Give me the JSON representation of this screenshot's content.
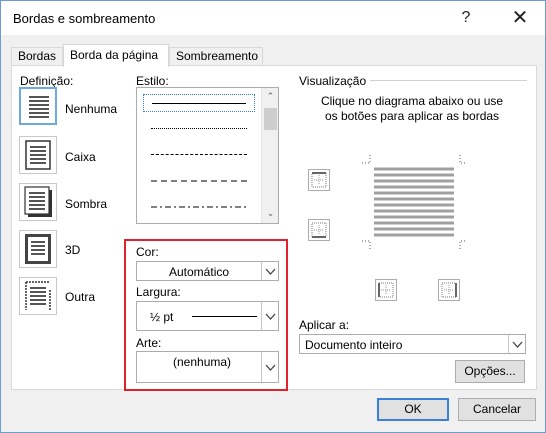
{
  "window": {
    "title": "Bordas e sombreamento",
    "help_glyph": "?",
    "close_glyph": "✕"
  },
  "tabs": [
    {
      "label": "Bordas",
      "active": false
    },
    {
      "label": "Borda da página",
      "active": true
    },
    {
      "label": "Sombreamento",
      "active": false
    }
  ],
  "definition": {
    "label": "Definição:",
    "items": [
      {
        "label": "Nenhuma",
        "selected": true
      },
      {
        "label": "Caixa",
        "selected": false
      },
      {
        "label": "Sombra",
        "selected": false
      },
      {
        "label": "3D",
        "selected": false
      },
      {
        "label": "Outra",
        "selected": false
      }
    ]
  },
  "style": {
    "label": "Estilo:",
    "scroll_up": "⌃",
    "scroll_down": "⌄",
    "lines": [
      "solid",
      "dotted",
      "dashed",
      "long-dash",
      "dash-dot"
    ]
  },
  "color": {
    "label": "Cor:",
    "value": "Automático"
  },
  "width": {
    "label": "Largura:",
    "value": "½ pt"
  },
  "art": {
    "label": "Arte:",
    "value": "(nenhuma)"
  },
  "preview": {
    "label": "Visualização",
    "help": "Clique no diagrama abaixo ou use os botões para aplicar as bordas"
  },
  "apply_to": {
    "label": "Aplicar a:",
    "value": "Documento inteiro"
  },
  "buttons": {
    "options": "Opções...",
    "ok": "OK",
    "cancel": "Cancelar"
  },
  "colors": {
    "accent": "#3c7fd8",
    "highlight": "#e0212e",
    "selected_preset": "#6fa8dc"
  }
}
